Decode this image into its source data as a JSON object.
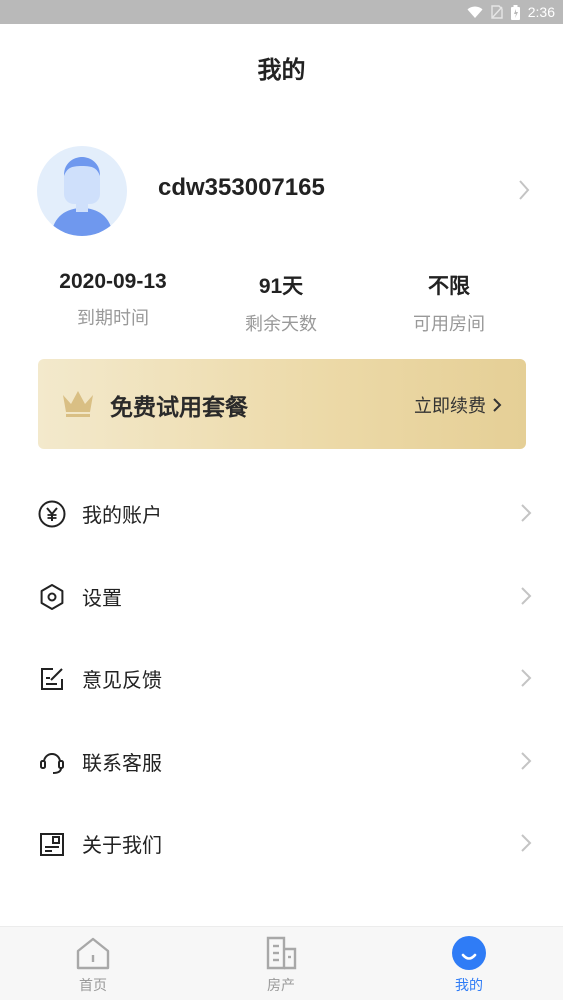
{
  "status_bar": {
    "time": "2:36"
  },
  "header": {
    "title": "我的"
  },
  "profile": {
    "username": "cdw353007165"
  },
  "stats": [
    {
      "value": "2020-09-13",
      "label": "到期时间"
    },
    {
      "value": "91天",
      "label": "剩余天数"
    },
    {
      "value": "不限",
      "label": "可用房间"
    }
  ],
  "plan": {
    "name": "免费试用套餐",
    "renew_label": "立即续费"
  },
  "menu": {
    "items": [
      {
        "label": "我的账户",
        "icon": "yen-icon"
      },
      {
        "label": "设置",
        "icon": "settings-icon"
      },
      {
        "label": "意见反馈",
        "icon": "feedback-icon"
      },
      {
        "label": "联系客服",
        "icon": "headset-icon"
      },
      {
        "label": "关于我们",
        "icon": "about-icon"
      }
    ]
  },
  "tabbar": {
    "tabs": [
      {
        "label": "首页",
        "icon": "home-icon"
      },
      {
        "label": "房产",
        "icon": "building-icon"
      },
      {
        "label": "我的",
        "icon": "profile-icon",
        "active": true
      }
    ]
  },
  "colors": {
    "accent": "#2f7cf6",
    "plan_gold": "#e8d49d"
  }
}
